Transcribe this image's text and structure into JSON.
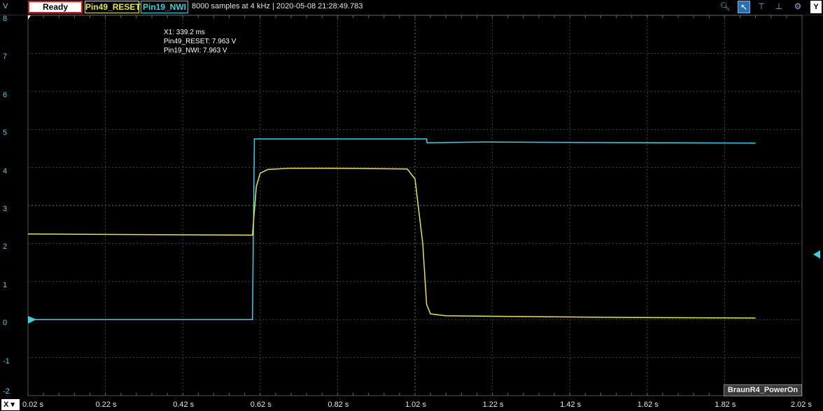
{
  "toolbar": {
    "y_unit": "V",
    "status": "Ready",
    "channel1": "Pin49_RESET",
    "channel2": "Pin19_NWI",
    "info": "8000 samples at 4 kHz | 2020-05-08 21:28:49.783",
    "y_button": "Y"
  },
  "cursor": {
    "x": "X1: 339.2 ms",
    "ch1": "Pin49_RESET: 7.963 V",
    "ch2": "Pin19_NWI: 7.963 V"
  },
  "x_axis": {
    "button": "X",
    "ticks": [
      "0.02 s",
      "0.22 s",
      "0.42 s",
      "0.62 s",
      "0.82 s",
      "1.02 s",
      "1.22 s",
      "1.42 s",
      "1.62 s",
      "1.82 s",
      "2.02 s"
    ]
  },
  "y_axis": {
    "ticks": [
      "8",
      "7",
      "6",
      "5",
      "4",
      "3",
      "2",
      "1",
      "0",
      "-1",
      "-2"
    ]
  },
  "label": "BraunR4_PowerOn",
  "colors": {
    "ch1": "#e6e63a",
    "ch2": "#3ad0e0",
    "ready_border": "#e21a1a"
  },
  "chart_data": {
    "type": "line",
    "xlim": [
      0.02,
      2.02
    ],
    "ylim": [
      -2,
      8
    ],
    "series": [
      {
        "name": "Pin49_RESET",
        "x": [
          0.02,
          0.6,
          0.61,
          0.62,
          0.64,
          0.7,
          0.8,
          1.0,
          1.02,
          1.04,
          1.05,
          1.06,
          1.1,
          1.3,
          1.5,
          1.7,
          1.9
        ],
        "y": [
          2.25,
          2.22,
          3.5,
          3.85,
          3.95,
          3.98,
          3.98,
          3.96,
          3.7,
          2.0,
          0.4,
          0.15,
          0.1,
          0.08,
          0.06,
          0.05,
          0.04
        ]
      },
      {
        "name": "Pin19_NWI",
        "x": [
          0.02,
          0.6,
          0.605,
          1.05,
          1.051,
          1.2,
          1.9
        ],
        "y": [
          0.0,
          0.0,
          4.75,
          4.75,
          4.65,
          4.67,
          4.64
        ]
      }
    ]
  }
}
